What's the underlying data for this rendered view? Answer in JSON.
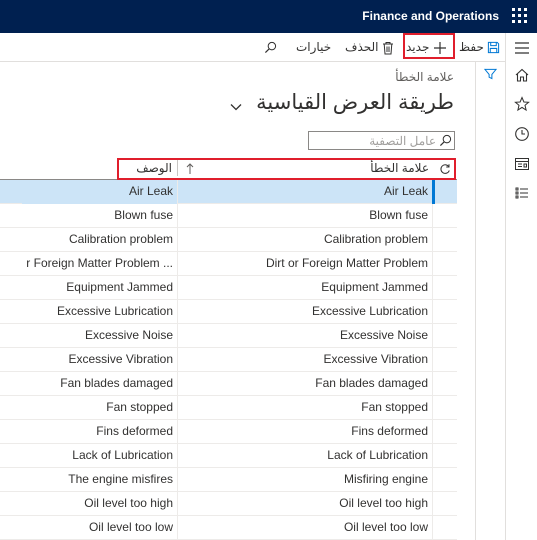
{
  "topbar": {
    "app_title": "Finance and Operations"
  },
  "actions": {
    "save": "حفظ",
    "new": "جديد",
    "delete": "الحذف",
    "options": "خيارات"
  },
  "page": {
    "caption": "علامة الخطأ",
    "title": "طريقة العرض القياسية"
  },
  "filter": {
    "placeholder": "عامل التصفية"
  },
  "grid": {
    "columns": [
      "علامة الخطأ",
      "الوصف"
    ],
    "rows": [
      {
        "code": "Air Leak",
        "description": "Air Leak"
      },
      {
        "code": "Blown fuse",
        "description": "Blown fuse"
      },
      {
        "code": "Calibration problem",
        "description": "Calibration problem"
      },
      {
        "code": "Dirt or Foreign Matter Problem",
        "description": "r Foreign Matter Problem ..."
      },
      {
        "code": "Equipment Jammed",
        "description": "Equipment Jammed"
      },
      {
        "code": "Excessive Lubrication",
        "description": "Excessive Lubrication"
      },
      {
        "code": "Excessive Noise",
        "description": "Excessive Noise"
      },
      {
        "code": "Excessive Vibration",
        "description": "Excessive Vibration"
      },
      {
        "code": "Fan blades damaged",
        "description": "Fan blades damaged"
      },
      {
        "code": "Fan stopped",
        "description": "Fan stopped"
      },
      {
        "code": "Fins deformed",
        "description": "Fins deformed"
      },
      {
        "code": "Lack of Lubrication",
        "description": "Lack of Lubrication"
      },
      {
        "code": "Misfiring engine",
        "description": "The engine misfires"
      },
      {
        "code": "Oil level too high",
        "description": "Oil level too high"
      },
      {
        "code": "Oil level too low",
        "description": "Oil level too low"
      }
    ]
  },
  "colors": {
    "topbar": "#002050",
    "highlight_box": "#e01e2c",
    "selected_row": "#cce4f7",
    "accent": "#0078d4"
  },
  "icons": {
    "waffle": "app-launcher-icon",
    "hamburger": "hamburger-menu-icon",
    "home": "home-icon",
    "star": "favorites-star-icon",
    "clock": "recent-clock-icon",
    "workspaces": "workspaces-icon",
    "modules": "modules-list-icon",
    "save": "save-floppy-icon",
    "new": "plus-icon",
    "delete": "trash-icon",
    "search": "search-icon",
    "filter": "filter-funnel-icon",
    "refresh": "refresh-icon",
    "sort": "sort-arrow-up-icon",
    "chevron": "chevron-down-icon"
  }
}
